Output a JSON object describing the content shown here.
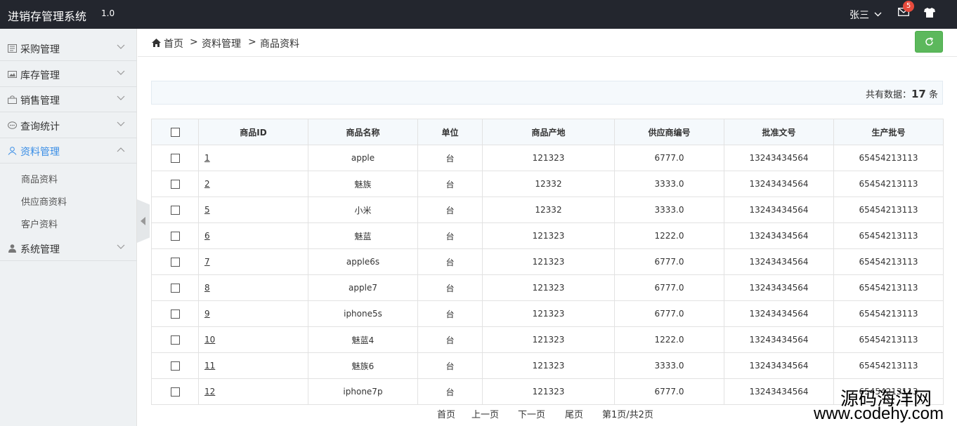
{
  "header": {
    "title": "进销存管理系统",
    "version": "1.0",
    "user": "张三",
    "mail_badge": "5"
  },
  "sidebar": {
    "items": [
      {
        "label": "采购管理",
        "icon": "document-icon"
      },
      {
        "label": "库存管理",
        "icon": "image-icon"
      },
      {
        "label": "销售管理",
        "icon": "bag-icon"
      },
      {
        "label": "查询统计",
        "icon": "chat-icon"
      },
      {
        "label": "资料管理",
        "icon": "user-icon",
        "active": true
      },
      {
        "label": "系统管理",
        "icon": "person-icon"
      }
    ],
    "submenu": [
      "商品资料",
      "供应商资料",
      "客户资料"
    ]
  },
  "breadcrumb": {
    "home": "首页",
    "level1": "资料管理",
    "level2": "商品资料",
    "separator": ">"
  },
  "summary": {
    "prefix": "共有数据：",
    "count": "17",
    "suffix": " 条"
  },
  "table": {
    "headers": [
      "商品ID",
      "商品名称",
      "单位",
      "商品产地",
      "供应商编号",
      "批准文号",
      "生产批号"
    ],
    "rows": [
      [
        "1",
        "apple",
        "台",
        "121323",
        "6777.0",
        "13243434564",
        "65454213113"
      ],
      [
        "2",
        "魅族",
        "台",
        "12332",
        "3333.0",
        "13243434564",
        "65454213113"
      ],
      [
        "5",
        "小米",
        "台",
        "12332",
        "3333.0",
        "13243434564",
        "65454213113"
      ],
      [
        "6",
        "魅蓝",
        "台",
        "121323",
        "1222.0",
        "13243434564",
        "65454213113"
      ],
      [
        "7",
        "apple6s",
        "台",
        "121323",
        "6777.0",
        "13243434564",
        "65454213113"
      ],
      [
        "8",
        "apple7",
        "台",
        "121323",
        "6777.0",
        "13243434564",
        "65454213113"
      ],
      [
        "9",
        "iphone5s",
        "台",
        "121323",
        "6777.0",
        "13243434564",
        "65454213113"
      ],
      [
        "10",
        "魅蓝4",
        "台",
        "121323",
        "1222.0",
        "13243434564",
        "65454213113"
      ],
      [
        "11",
        "魅族6",
        "台",
        "121323",
        "3333.0",
        "13243434564",
        "65454213113"
      ],
      [
        "12",
        "iphone7p",
        "台",
        "121323",
        "6777.0",
        "13243434564",
        "65454213113"
      ]
    ]
  },
  "pager": {
    "first": "首页",
    "prev": "上一页",
    "next": "下一页",
    "last": "尾页",
    "info": "第1页/共2页"
  },
  "watermark": {
    "line1": "源码海洋网",
    "line2": "www.codehy.com"
  },
  "colors": {
    "topbar": "#23262e",
    "accent": "#3a8ee6",
    "refresh": "#5cb85c",
    "badge": "#e64a3c"
  }
}
